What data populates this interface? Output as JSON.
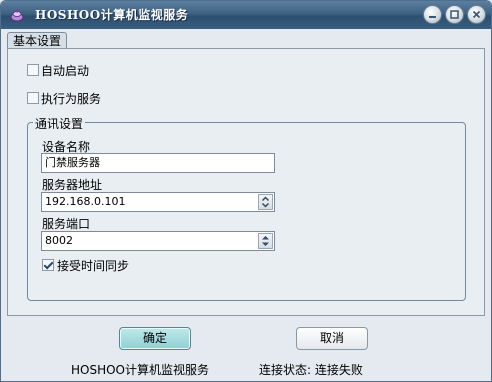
{
  "window": {
    "title": "HOSHOO计算机监视服务"
  },
  "tabs": [
    {
      "label": "基本设置",
      "selected": true
    }
  ],
  "options": {
    "auto_start": {
      "label": "自动启动",
      "checked": false
    },
    "run_as_service": {
      "label": "执行为服务",
      "checked": false
    }
  },
  "comm": {
    "group_title": "通讯设置",
    "device_name_label": "设备名称",
    "device_name_value": "门禁服务器",
    "server_address_label": "服务器地址",
    "server_address_value": "192.168.0.101",
    "server_port_label": "服务端口",
    "server_port_value": "8002",
    "time_sync_label": "接受时间同步",
    "time_sync_checked": true
  },
  "buttons": {
    "ok_label": "确定",
    "cancel_label": "取消"
  },
  "status": {
    "app_name": "HOSHOO计算机监视服务",
    "connection_text": "连接状态: 连接失败"
  },
  "colors": {
    "title_bar": "#3e6282",
    "ok_button": "#8fd0d4",
    "border": "#6f8aa3"
  }
}
